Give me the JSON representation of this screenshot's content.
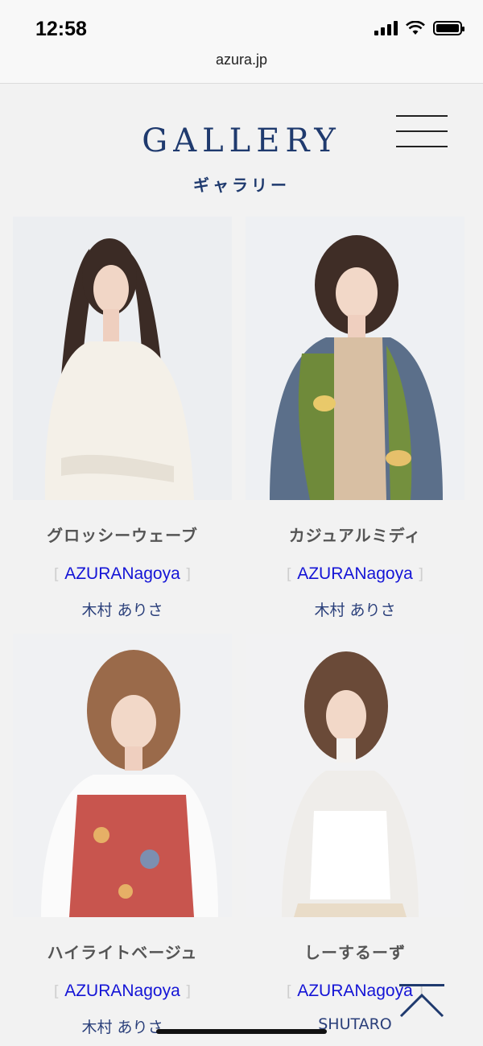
{
  "status_bar": {
    "time": "12:58",
    "url": "azura.jp"
  },
  "header": {
    "title_en": "GALLERY",
    "title_ja": "ギャラリー"
  },
  "gallery": [
    {
      "style": "グロッシーウェーブ",
      "salon": "AZURANagoya",
      "stylist": "木村 ありさ"
    },
    {
      "style": "カジュアルミディ",
      "salon": "AZURANagoya",
      "stylist": "木村 ありさ"
    },
    {
      "style": "ハイライトベージュ",
      "salon": "AZURANagoya",
      "stylist": "木村 ありさ"
    },
    {
      "style": "しーするーず",
      "salon": "AZURANagoya",
      "stylist": "SHUTARO"
    }
  ],
  "salon_bracket_open": "[",
  "salon_bracket_close": "]",
  "colors": {
    "brand": "#1f3a6e",
    "link": "#1414d6",
    "background": "#f2f2f2"
  },
  "icons": {
    "menu": "hamburger-menu-icon",
    "scroll_top": "chevron-up-icon"
  }
}
